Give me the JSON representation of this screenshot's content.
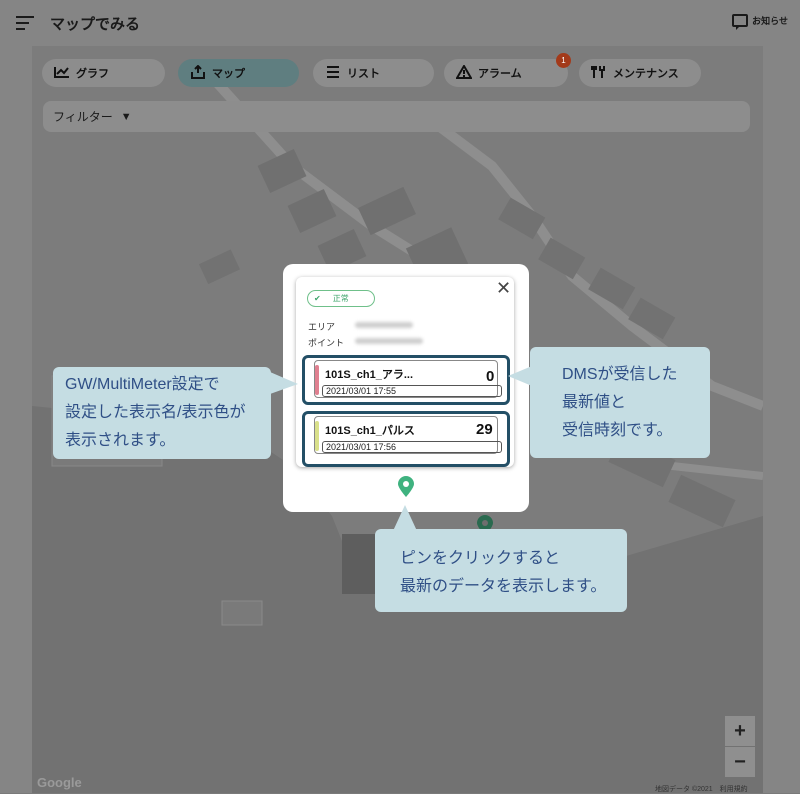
{
  "header": {
    "title": "マップでみる",
    "notice_label": "お知らせ"
  },
  "tabs": [
    {
      "label": "グラフ",
      "icon": "chart-line-icon",
      "active": false
    },
    {
      "label": "マップ",
      "icon": "map-upload-icon",
      "active": true
    },
    {
      "label": "リスト",
      "icon": "list-icon",
      "active": false
    },
    {
      "label": "アラーム",
      "icon": "warning-icon",
      "active": false,
      "badge": "1"
    },
    {
      "label": "メンテナンス",
      "icon": "tools-icon",
      "active": false
    }
  ],
  "filter": {
    "label": "フィルター",
    "arrow": "▼"
  },
  "popup": {
    "status": "正常",
    "status_check": "✔",
    "close": "✕",
    "area_label": "エリア",
    "point_label": "ポイント",
    "channels": [
      {
        "name": "101S_ch1_アラ...",
        "time": "2021/03/01 17:55",
        "value": "0",
        "color": "#e08090"
      },
      {
        "name": "101S_ch1_パルス",
        "time": "2021/03/01 17:56",
        "value": "29",
        "color": "#d9e08a"
      }
    ]
  },
  "callouts": {
    "left": [
      "GW/MultiMeter設定で",
      "設定した表示名/表示色が",
      "表示されます。"
    ],
    "right": [
      "DMSが受信した",
      "最新値と",
      "受信時刻です。"
    ],
    "bottom": [
      "ピンをクリックすると",
      "最新のデータを表示します。"
    ]
  },
  "map": {
    "zoom_in": "+",
    "zoom_out": "−",
    "google": "Google",
    "attribution": "地図データ ©2021　利用規約"
  },
  "colors": {
    "accent": "#234f66",
    "callout_bg": "#c5dde3",
    "pin": "#3fb27f"
  }
}
